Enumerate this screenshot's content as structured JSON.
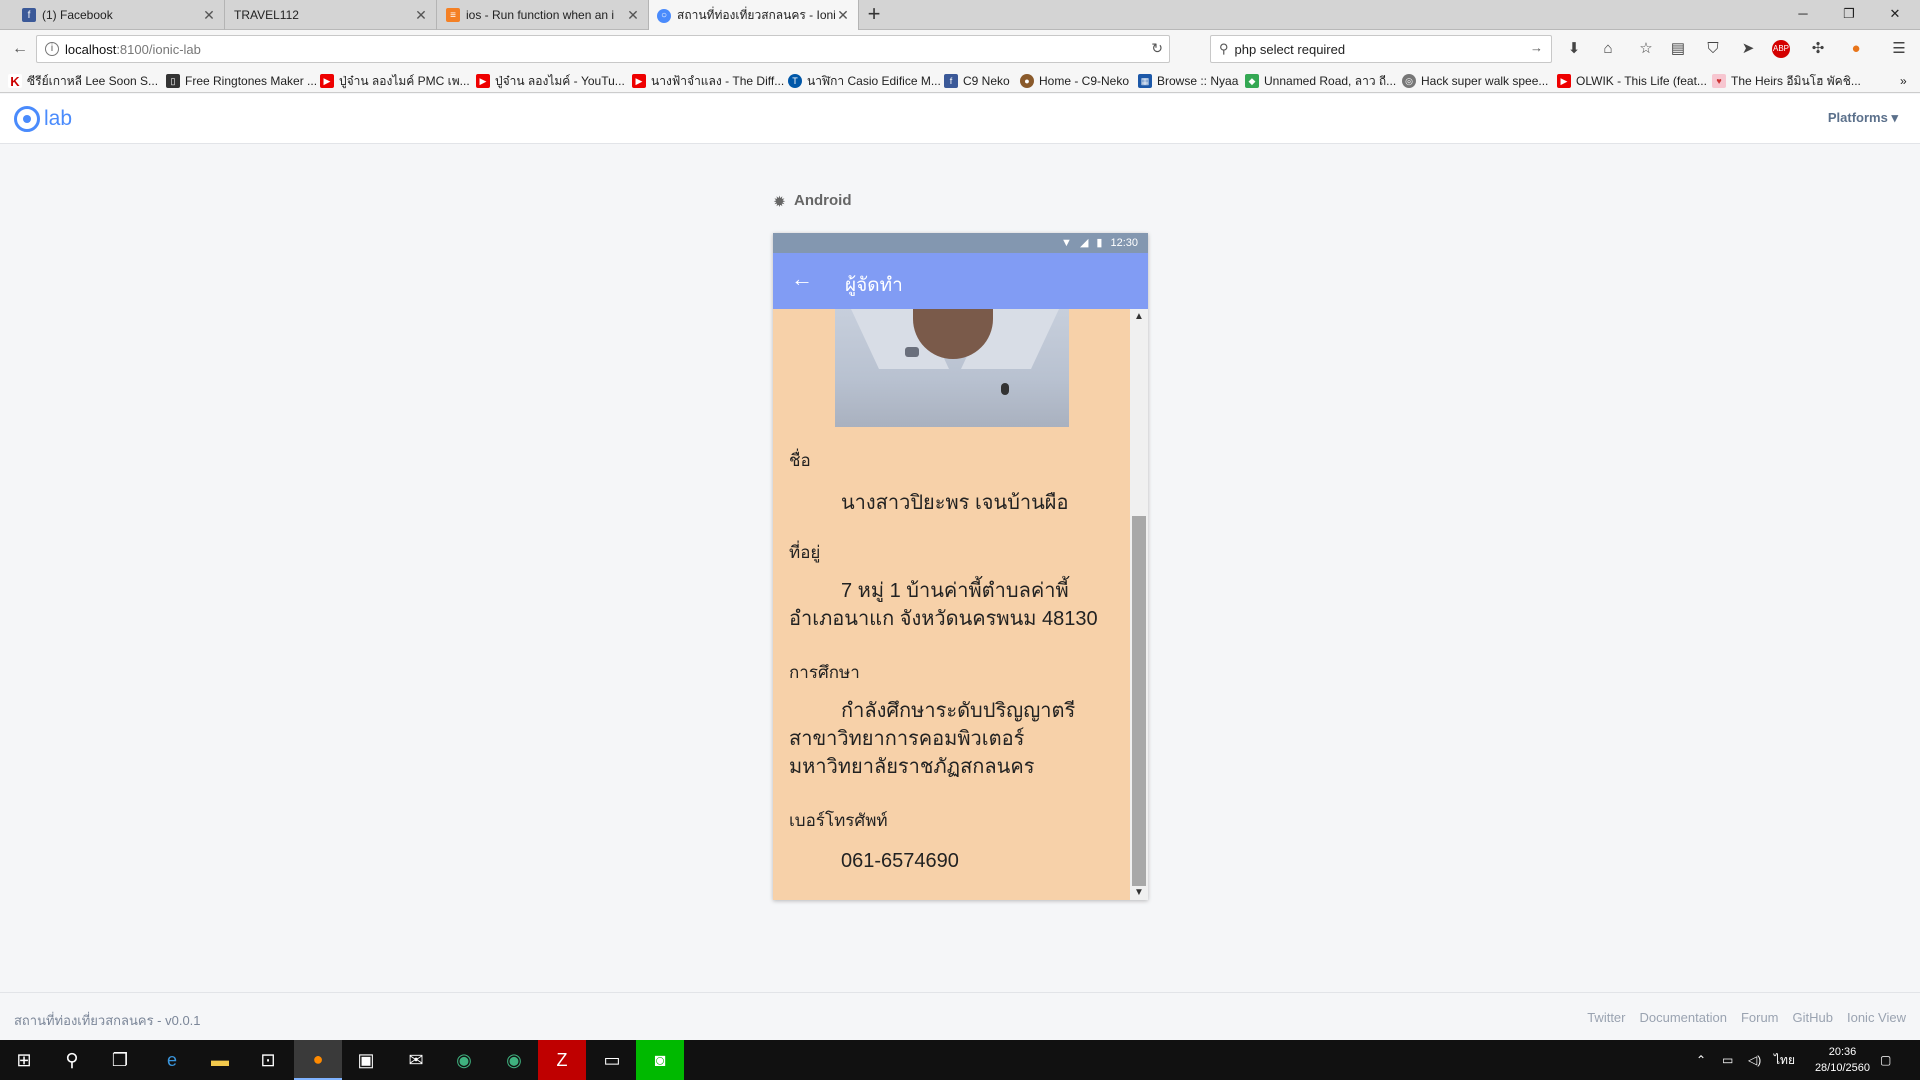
{
  "browser": {
    "tabs": [
      {
        "title": "(1) Facebook",
        "icon": "facebook-icon",
        "color": "#3b5998"
      },
      {
        "title": "TRAVEL112",
        "icon": "page-icon",
        "color": "#999999"
      },
      {
        "title": "ios - Run function when an i",
        "icon": "stackoverflow-icon",
        "color": "#f48024"
      },
      {
        "title": "สถานที่ท่องเที่ยวสกลนคร - Ioni",
        "icon": "ionic-icon",
        "color": "#4a8bfc"
      }
    ],
    "url_host": "localhost",
    "url_path": ":8100/ionic-lab",
    "search_value": "php select required",
    "bookmarks": [
      "ซีรีย์เกาหลี Lee Soon S...",
      "Free Ringtones Maker ...",
      "ปู่จ๋าน ลองไมค์ PMC เพ...",
      "ปู่จ๋าน ลองไมค์ - YouTu...",
      "นางฟ้าจำแลง - The Diff...",
      "นาฬิกา Casio Edifice M...",
      "C9 Neko",
      "Home - C9-Neko",
      "Browse :: Nyaa",
      "Unnamed Road, ลาว ถี...",
      "Hack super walk spee...",
      "OLWIK - This Life (feat...",
      "The Heirs อีมินโฮ พัคชิ..."
    ]
  },
  "lab": {
    "logo_text": "lab",
    "platforms_label": "Platforms ▾",
    "platform_name": "Android",
    "footer_app": "สถานที่ท่องเที่ยวสกลนคร - v0.0.1",
    "footer_links": [
      "Twitter",
      "Documentation",
      "Forum",
      "GitHub",
      "Ionic View"
    ]
  },
  "phone": {
    "status_time": "12:30",
    "page_title": "ผู้จัดทำ",
    "name_label": "ชื่อ",
    "name_value": "นางสาวปิยะพร เจนบ้านผือ",
    "address_label": "ที่อยู่",
    "address_value": "7 หมู่ 1 บ้านค่าพี้ตำบลค่าพี้ อำเภอนาแก จังหวัดนครพนม 48130",
    "education_label": "การศึกษา",
    "education_value": "กำลังศึกษาระดับปริญญาตรี สาขาวิทยาการคอมพิวเตอร์ มหาวิทยาลัยราชภัฏสกลนคร",
    "phone_label": "เบอร์โทรศัพท์",
    "phone_value": "061-6574690"
  },
  "taskbar": {
    "language": "ไทย",
    "time": "20:36",
    "date": "28/10/2560"
  }
}
